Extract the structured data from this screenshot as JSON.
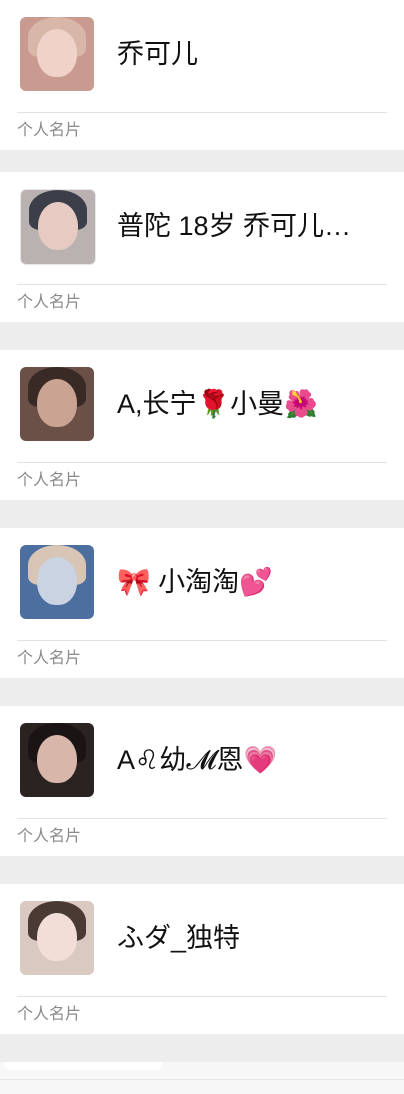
{
  "cards": [
    {
      "name": "乔可儿",
      "label": "个人名片",
      "avatar": "avatar-1"
    },
    {
      "name": "普陀 18岁 乔可儿…",
      "label": "个人名片",
      "avatar": "avatar-2"
    },
    {
      "name": "A,长宁🌹小曼🌺",
      "label": "个人名片",
      "avatar": "avatar-3"
    },
    {
      "name": "🎀 小淘淘💕",
      "label": "个人名片",
      "avatar": "avatar-4"
    },
    {
      "name": "A♌幼𝓜恩💗",
      "label": "个人名片",
      "avatar": "avatar-5"
    },
    {
      "name": "ふダ_独特",
      "label": "个人名片",
      "avatar": "avatar-6"
    }
  ],
  "colors": {
    "background": "#ededed",
    "card": "#ffffff",
    "name_text": "#111111",
    "label_text": "#8a8a8a"
  }
}
